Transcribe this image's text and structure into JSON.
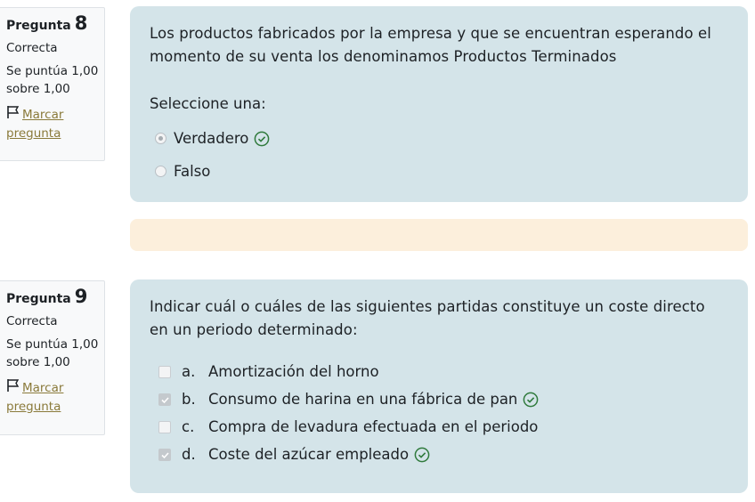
{
  "questions": [
    {
      "label": "Pregunta",
      "number": "8",
      "state": "Correcta",
      "grade_line1": "Se puntúa 1,00",
      "grade_line2": "sobre 1,00",
      "flag_line1": "Marcar",
      "flag_line2": "pregunta",
      "text": "Los productos fabricados por la empresa y que se encuentran esperando el momento de su venta los denominamos Productos Terminados",
      "prompt": "Seleccione una:",
      "options": [
        {
          "label": "Verdadero",
          "checked": true,
          "correct": true
        },
        {
          "label": "Falso",
          "checked": false,
          "correct": false
        }
      ]
    },
    {
      "label": "Pregunta",
      "number": "9",
      "state": "Correcta",
      "grade_line1": "Se puntúa 1,00",
      "grade_line2": "sobre 1,00",
      "flag_line1": "Marcar",
      "flag_line2": "pregunta",
      "text": "Indicar cuál o cuáles de las siguientes partidas constituye un coste directo en un periodo determinado:",
      "options": [
        {
          "letter": "a.",
          "label": "Amortización del horno",
          "checked": false,
          "correct": false
        },
        {
          "letter": "b.",
          "label": "Consumo de harina en una fábrica de pan",
          "checked": true,
          "correct": true
        },
        {
          "letter": "c.",
          "label": "Compra de levadura efectuada en el periodo",
          "checked": false,
          "correct": false
        },
        {
          "letter": "d.",
          "label": "Coste del azúcar empleado",
          "checked": true,
          "correct": true
        }
      ]
    }
  ],
  "colors": {
    "content_bg": "#d4e4e9",
    "feedback_bg": "#fcefdc",
    "correct_icon": "#2f7a3c",
    "flag_link": "#8a7a3a"
  },
  "icons": {
    "flag": "flag-icon",
    "correct": "check-circle-icon"
  }
}
